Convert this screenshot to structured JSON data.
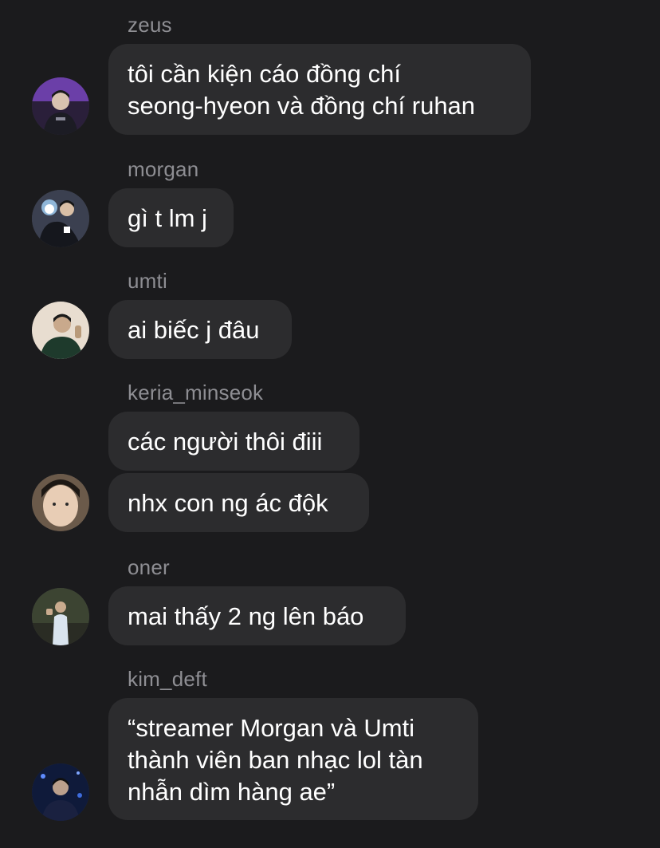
{
  "messages": [
    {
      "sender": "zeus",
      "avatar_icon": "profile-photo-icon",
      "bubbles": [
        "tôi cần kiện cáo đồng chí\nseong-hyeon và đồng chí ruhan"
      ]
    },
    {
      "sender": "morgan",
      "avatar_icon": "profile-photo-icon",
      "bubbles": [
        "gì t lm j"
      ]
    },
    {
      "sender": "umti",
      "avatar_icon": "profile-photo-icon",
      "bubbles": [
        "ai biếc j đâu"
      ]
    },
    {
      "sender": "keria_minseok",
      "avatar_icon": "profile-photo-icon",
      "bubbles": [
        "các người thôi điii",
        "nhx con ng ác độk"
      ]
    },
    {
      "sender": "oner",
      "avatar_icon": "profile-photo-icon",
      "bubbles": [
        "mai thấy 2 ng lên báo"
      ]
    },
    {
      "sender": "kim_deft",
      "avatar_icon": "profile-photo-icon",
      "bubbles": [
        "“streamer Morgan và Umti\nthành viên ban nhạc lol tàn\nnhẫn dìm hàng ae”"
      ]
    }
  ],
  "colors": {
    "background": "#1b1b1d",
    "bubble": "#2c2c2e",
    "sender_name": "#8e8e93",
    "text": "#ffffff"
  }
}
